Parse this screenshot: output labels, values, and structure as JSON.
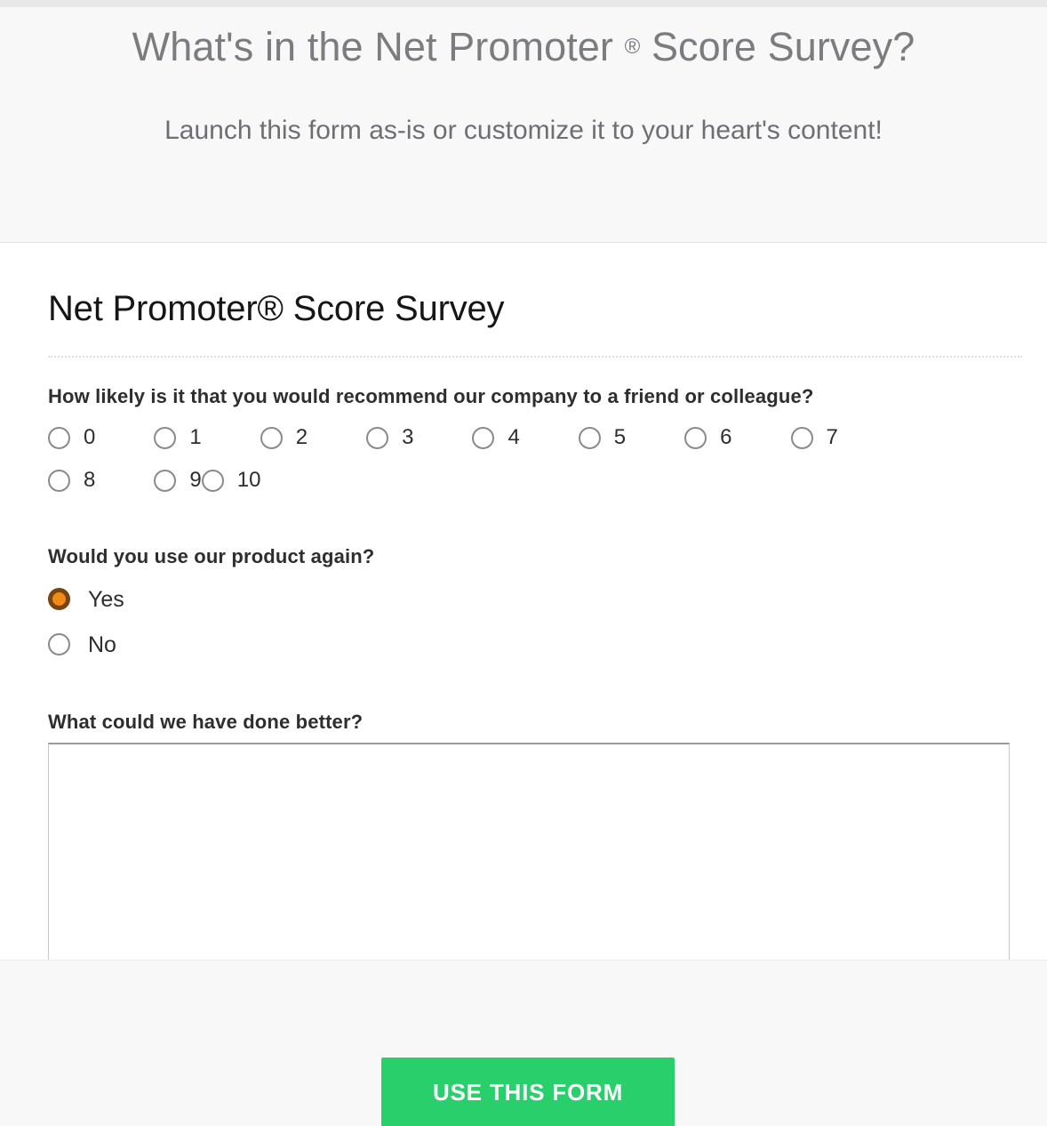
{
  "promo": {
    "title_before": "What's in the Net Promoter",
    "title_reg": "®",
    "title_after": "Score Survey?",
    "subtitle": "Launch this form as-is or customize it to your heart's content!"
  },
  "form": {
    "title": "Net Promoter® Score Survey",
    "questions": [
      {
        "label": "How likely is it that you would recommend our company to a friend or colleague?",
        "type": "radio-scale",
        "options": [
          "0",
          "1",
          "2",
          "3",
          "4",
          "5",
          "6",
          "7",
          "8",
          "9",
          "10"
        ],
        "selected": null
      },
      {
        "label": "Would you use our product again?",
        "type": "radio-stack",
        "options": [
          "Yes",
          "No"
        ],
        "selected": "Yes"
      },
      {
        "label": "What could we have done better?",
        "type": "textarea",
        "value": "",
        "placeholder": ""
      }
    ]
  },
  "footer": {
    "cta_label": "USE THIS FORM"
  },
  "colors": {
    "promo_background": "#f8f8f9",
    "promo_title_text": "#7b7c80",
    "promo_subtitle_text": "#6e6f73",
    "form_background": "#ffffff",
    "form_title_text": "#161616",
    "question_label_text": "#2e2e2e",
    "radio_border": "#8a8a8a",
    "radio_checked_fill": "#f08a16",
    "radio_checked_ring": "#7a4410",
    "textarea_border": "#c8c8c8",
    "cta_background": "#29cf6a",
    "cta_text": "#ffffff",
    "divider": "#dedede"
  }
}
